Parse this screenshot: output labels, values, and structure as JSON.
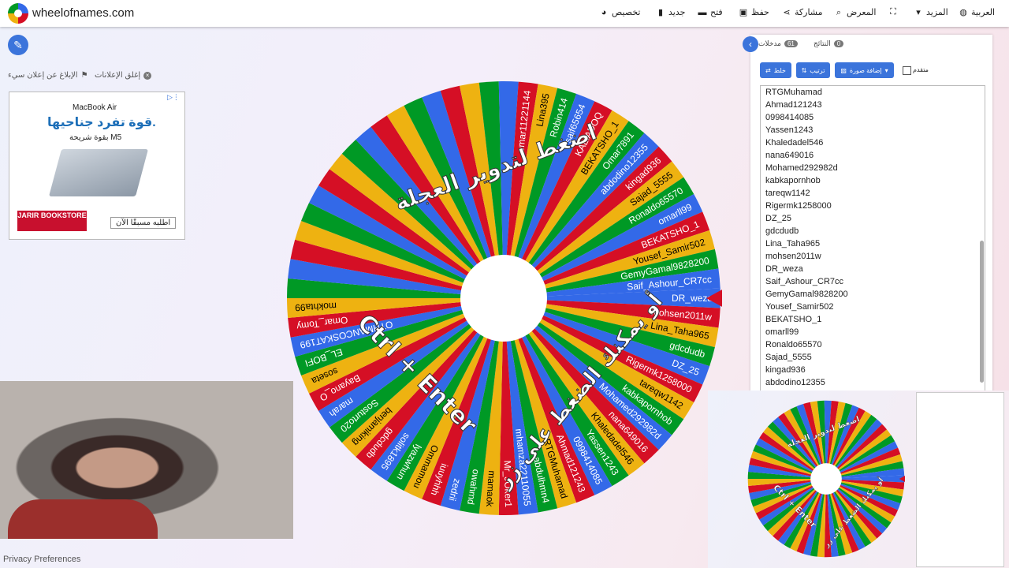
{
  "site": {
    "title": "wheelofnames.com"
  },
  "menu": {
    "language": "العربية",
    "more": "المزيد",
    "fullscreen": "",
    "gallery": "المعرض",
    "share": "مشاركة",
    "save": "حفظ",
    "open": "فتح",
    "new": "جديد",
    "customize": "تخصيص"
  },
  "ads": {
    "close": "إغلق الإعلانات",
    "report": "الإبلاغ عن إعلان سيء"
  },
  "ad": {
    "brand": "MacBook Air",
    "headline": "قوة تفرد جناحيها.",
    "sub": "بقوة شريحة M5",
    "store": "JARIR BOOKSTORE",
    "cta": "اطلبه مسبقًا الآن"
  },
  "tabs": {
    "entries_label": "مدخلات",
    "entries_count": "61",
    "results_label": "النتائج",
    "results_count": "0"
  },
  "toolbar": {
    "shuffle": "خلط",
    "sort": "ترتيب",
    "add_image": "إضافة صورة",
    "advanced": "متقدم"
  },
  "entries": [
    "RTGMuhamad",
    "Ahmad121243",
    "0998414085",
    "Yassen1243",
    "Khaledadel546",
    "nana649016",
    "Mohamed292982d",
    "kabkapornhob",
    "tareqw1142",
    "Rigermk1258000",
    "DZ_25",
    "gdcdudb",
    "Lina_Taha965",
    "mohsen2011w",
    "DR_weza",
    "Saif_Ashour_CR7cc",
    "GemyGamal9828200",
    "Yousef_Samir502",
    "BEKATSHO_1",
    "omarll99",
    "Ronaldo65570",
    "Sajad_5555",
    "kingad936",
    "abdodino12355"
  ],
  "wheel": {
    "top_text": "اضغط لتدوير العجلة",
    "ctrl_text": "Ctrl + Enter",
    "or_text": "أو يمكنك الضغط على زر",
    "colors": [
      "#3369e8",
      "#d50f25",
      "#eeb211",
      "#009925"
    ],
    "labels": [
      "DR_weza",
      "mohsen2011w",
      "Lina_Taha965",
      "gdcdudb",
      "DZ_25",
      "Rigermk1258000",
      "tareqw1142",
      "kabkapornhob",
      "Mohamed292982d",
      "nana649016",
      "Khaledadel546",
      "Yassen1243",
      "0998414085",
      "Ahmad121243",
      "RTGMuhamad",
      "abdulhmn4",
      "mhamza22110055",
      "Mr_JOker1",
      "mamaok",
      "owahmd",
      "zedrii",
      "iuuyhhh",
      "Ommamou",
      "lyazwhun",
      "solitk1895",
      "gdcdudb",
      "benjamiking",
      "Sosturto20",
      "marah",
      "Bayano_O",
      "soseta",
      "EL_BOFI",
      "OTHMANCOSKAT199",
      "Omar_Tomy",
      "mokhta99",
      "",
      "",
      "",
      "",
      "",
      "",
      "",
      "",
      "",
      "",
      "",
      "",
      "",
      "",
      "",
      "",
      "",
      "",
      "omar11221144",
      "Lina395",
      "Robin414",
      "saif65654",
      "KALIADOQ",
      "BEKATSHO_1",
      "Omar7891",
      "abdodino12355",
      "kingad936",
      "Sajad_5555",
      "Ronaldo65570",
      "omarll99",
      "BEKATSHO_1",
      "Yousef_Samir502",
      "GemyGamal9828200",
      "Saif_Ashour_CR7cc"
    ]
  },
  "footer": {
    "privacy": "Privacy Preferences"
  }
}
